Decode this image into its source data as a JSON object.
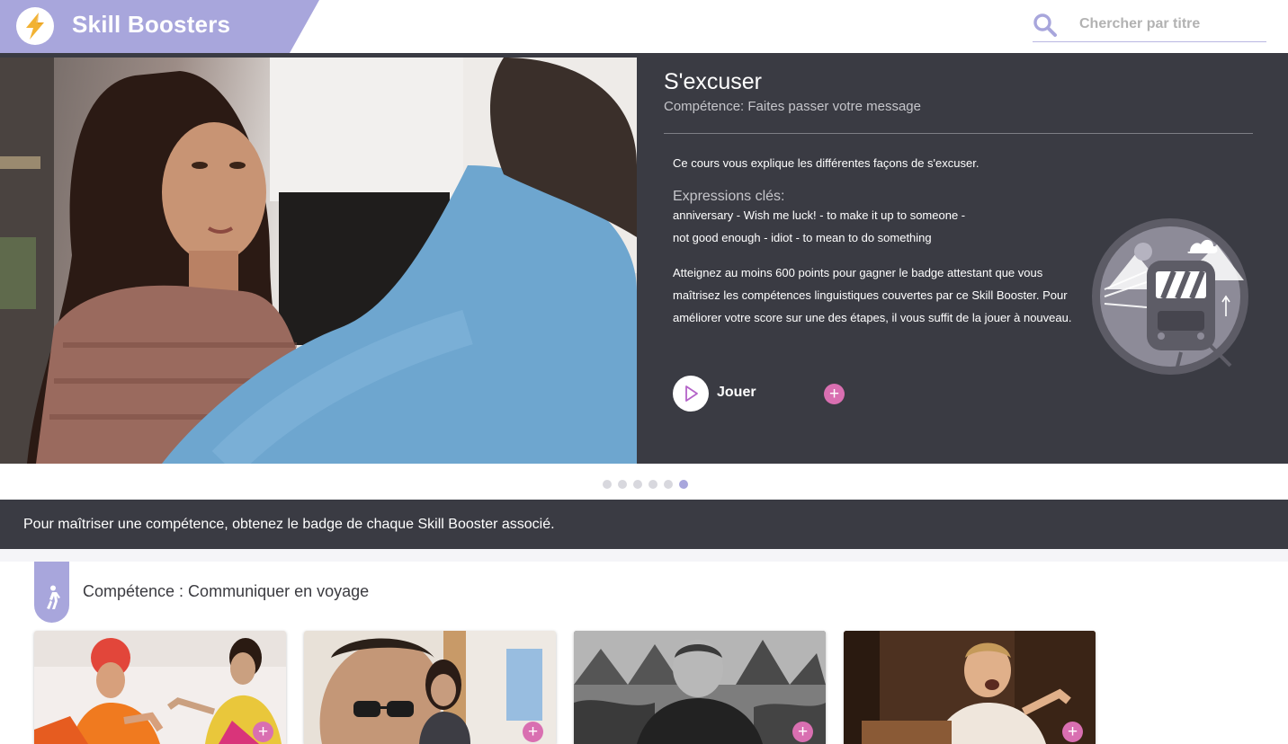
{
  "header": {
    "app_title": "Skill Boosters",
    "logo_icon": "lightning-bolt-icon",
    "search_placeholder": "Chercher par titre",
    "search_icon": "search-icon"
  },
  "hero": {
    "title": "S'excuser",
    "subtitle": "Compétence: Faites passer votre message",
    "description": "Ce cours vous explique les différentes façons de s'excuser.",
    "keywords_label": "Expressions clés:",
    "keywords_line1": "anniversary  - Wish me luck!  - to make it up to someone  -",
    "keywords_line2": "not good enough  - idiot  - to mean to do something",
    "goal_text": "Atteignez au moins 600 points pour gagner le badge attestant que vous maîtrisez les compétences linguistiques couvertes par ce Skill Booster. Pour améliorer votre score sur une des étapes, il vous suffit de la jouer à nouveau.",
    "play_label": "Jouer",
    "badge_icon": "train-badge-icon"
  },
  "carousel": {
    "total": 6,
    "active_index": 5
  },
  "info_bar": {
    "text": "Pour maîtriser une compétence, obtenez le badge de chaque Skill Booster associé."
  },
  "section": {
    "icon": "walking-person-icon",
    "title": "Compétence : Communiquer en voyage"
  },
  "cards": [
    {
      "thumbnail": "man-and-woman-in-traditional-indian-dress"
    },
    {
      "thumbnail": "man-with-sunglasses-and-woman"
    },
    {
      "thumbnail": "man-in-forest-black-and-white"
    },
    {
      "thumbnail": "man-laughing-at-table"
    }
  ],
  "colors": {
    "accent": "#a8a6dc",
    "dark_panel": "#3a3b43",
    "add_button": "#d96fb1"
  }
}
